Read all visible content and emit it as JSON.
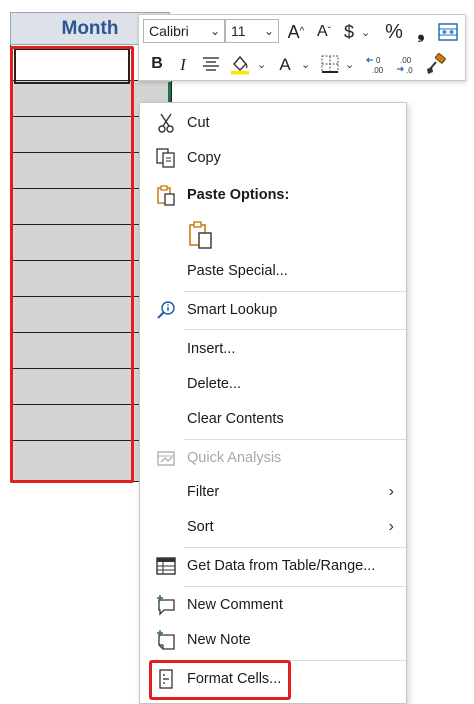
{
  "sheet": {
    "header": "Month"
  },
  "toolbar": {
    "font_name": "Calibri",
    "font_size": "11",
    "grow_font": "A",
    "shrink_font": "A",
    "currency": "$",
    "percent": "%",
    "comma": "9",
    "bold": "B",
    "italic": "I",
    "font_color": "A",
    "dec_inc_label": ".00",
    "dec_dec_label": ".0"
  },
  "menu": {
    "cut": "Cut",
    "copy": "Copy",
    "paste_options": "Paste Options:",
    "paste_special": "Paste Special...",
    "smart_lookup": "Smart Lookup",
    "insert": "Insert...",
    "delete": "Delete...",
    "clear_contents": "Clear Contents",
    "quick_analysis": "Quick Analysis",
    "filter": "Filter",
    "sort": "Sort",
    "get_data": "Get Data from Table/Range...",
    "new_comment": "New Comment",
    "new_note": "New Note",
    "format_cells": "Format Cells..."
  },
  "colors": {
    "highlight_red": "#e01f1f",
    "header_blue": "#2f5597",
    "excel_green": "#217346",
    "icon_blue": "#1f5ea8",
    "paste_orange": "#c87d14"
  }
}
